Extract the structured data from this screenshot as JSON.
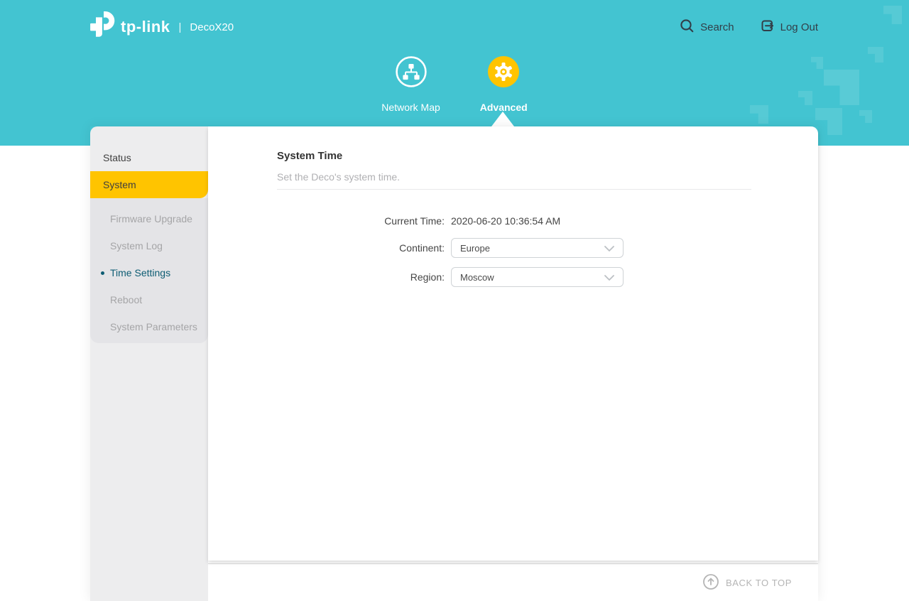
{
  "colors": {
    "teal": "#43c4d1",
    "yellow": "#ffc400",
    "sidebar_gray": "#ededee",
    "submenu_gray": "#e4e4e7",
    "active_link": "#0d5c73",
    "header_text": "#323e48"
  },
  "brand": {
    "name": "tp-link",
    "separator": "|",
    "model": "DecoX20"
  },
  "header": {
    "search": "Search",
    "logout": "Log Out"
  },
  "nav": {
    "items": [
      {
        "label": "Network Map",
        "icon": "network-map-icon",
        "active": false
      },
      {
        "label": "Advanced",
        "icon": "gear-icon",
        "active": true
      }
    ]
  },
  "sidebar": {
    "items": [
      {
        "label": "Status",
        "selected": false
      },
      {
        "label": "System",
        "selected": true
      }
    ],
    "submenu": [
      {
        "label": "Firmware Upgrade",
        "active": false
      },
      {
        "label": "System Log",
        "active": false
      },
      {
        "label": "Time Settings",
        "active": true
      },
      {
        "label": "Reboot",
        "active": false
      },
      {
        "label": "System Parameters",
        "active": false
      }
    ]
  },
  "content": {
    "title": "System Time",
    "subtitle": "Set the Deco's system time.",
    "fields": {
      "current_time": {
        "label": "Current Time:",
        "value": "2020-06-20 10:36:54 AM"
      },
      "continent": {
        "label": "Continent:",
        "value": "Europe"
      },
      "region": {
        "label": "Region:",
        "value": "Moscow"
      }
    }
  },
  "footer": {
    "back_to_top": "BACK TO TOP"
  }
}
